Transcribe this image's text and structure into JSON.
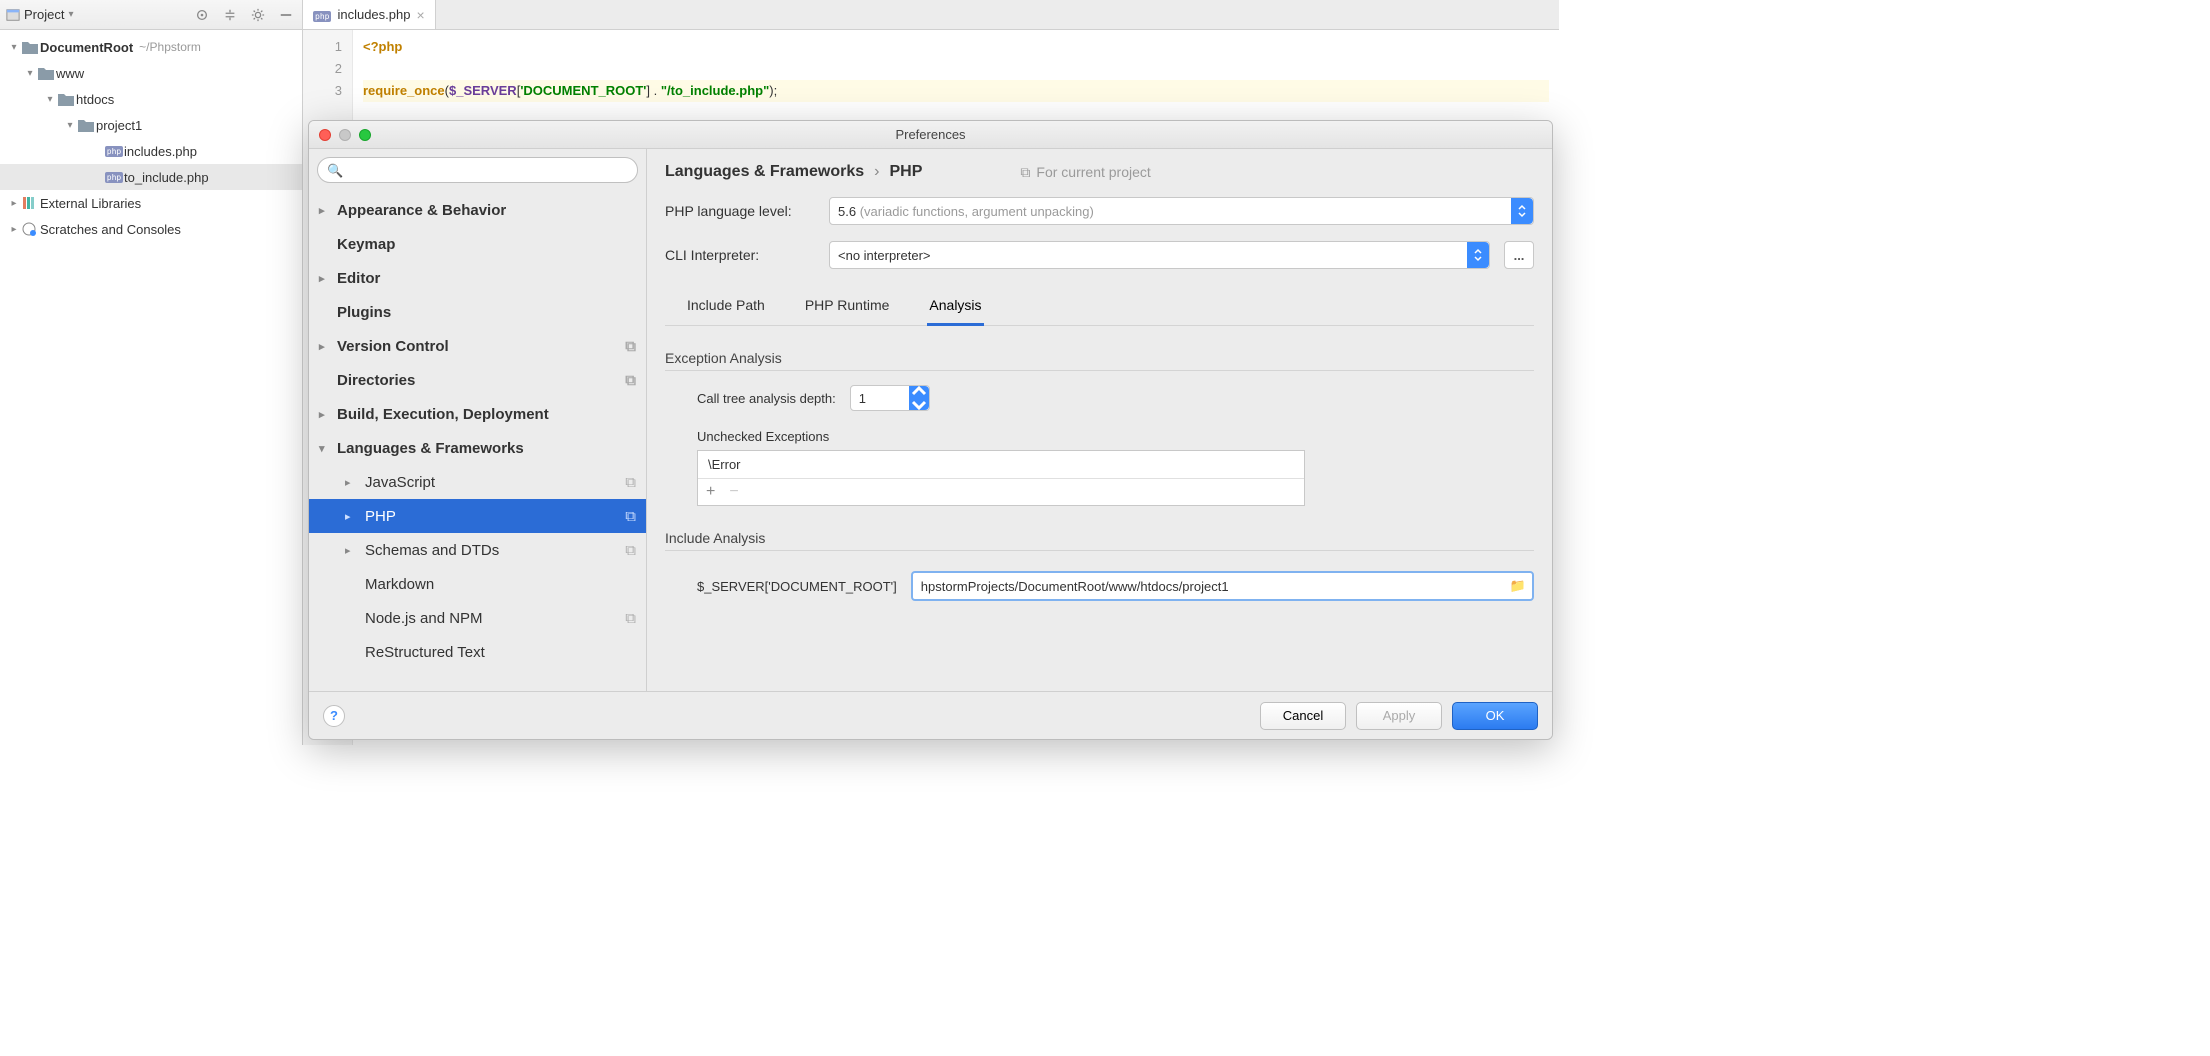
{
  "project": {
    "dropdown_label": "Project",
    "root": {
      "name": "DocumentRoot",
      "path": "~/Phpstorm"
    },
    "www": "www",
    "htdocs": "htdocs",
    "project1": "project1",
    "files": [
      "includes.php",
      "to_include.php"
    ],
    "external_libraries": "External Libraries",
    "scratches": "Scratches and Consoles"
  },
  "editor": {
    "tab": "includes.php",
    "gutter": [
      "1",
      "2",
      "3"
    ],
    "code": {
      "open_tag": "<?php",
      "require": "require_once",
      "server": "$_SERVER",
      "key": "'DOCUMENT_ROOT'",
      "concat": " . ",
      "path": "\"/to_include.php\"",
      "end": ");"
    }
  },
  "dialog": {
    "title": "Preferences",
    "search_placeholder": "",
    "sidebar": {
      "items": [
        {
          "label": "Appearance & Behavior",
          "top": true,
          "arrow": true
        },
        {
          "label": "Keymap",
          "top": true
        },
        {
          "label": "Editor",
          "top": true,
          "arrow": true
        },
        {
          "label": "Plugins",
          "top": true
        },
        {
          "label": "Version Control",
          "top": true,
          "arrow": true,
          "scope": true
        },
        {
          "label": "Directories",
          "top": true,
          "scope": true
        },
        {
          "label": "Build, Execution, Deployment",
          "top": true,
          "arrow": true
        },
        {
          "label": "Languages & Frameworks",
          "top": true,
          "arrow": true,
          "expanded": true
        },
        {
          "label": "JavaScript",
          "child": true,
          "arrow": true,
          "scope": true
        },
        {
          "label": "PHP",
          "child": true,
          "arrow": true,
          "scope": true,
          "selected": true
        },
        {
          "label": "Schemas and DTDs",
          "child": true,
          "arrow": true,
          "scope": true
        },
        {
          "label": "Markdown",
          "child": true
        },
        {
          "label": "Node.js and NPM",
          "child": true,
          "scope": true
        },
        {
          "label": "ReStructured Text",
          "child": true
        }
      ]
    },
    "content": {
      "breadcrumb": [
        "Languages & Frameworks",
        "PHP"
      ],
      "scope_label": "For current project",
      "php_level_label": "PHP language level:",
      "php_level_value": "5.6",
      "php_level_suffix": "(variadic functions, argument unpacking)",
      "cli_label": "CLI Interpreter:",
      "cli_value": "<no interpreter>",
      "more": "...",
      "tabs": [
        "Include Path",
        "PHP Runtime",
        "Analysis"
      ],
      "active_tab": "Analysis",
      "exception_legend": "Exception Analysis",
      "depth_label": "Call tree analysis depth:",
      "depth_value": "1",
      "unchecked_legend": "Unchecked Exceptions",
      "unchecked_item": "\\Error",
      "include_legend": "Include Analysis",
      "server_label": "$_SERVER['DOCUMENT_ROOT']",
      "server_path": "hpstormProjects/DocumentRoot/www/htdocs/project1"
    },
    "footer": {
      "cancel": "Cancel",
      "apply": "Apply",
      "ok": "OK"
    }
  }
}
